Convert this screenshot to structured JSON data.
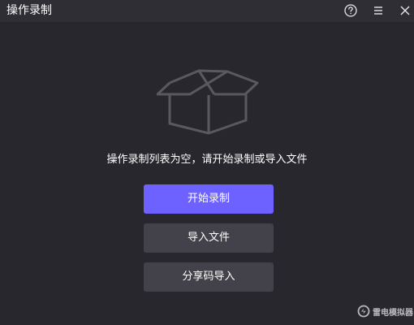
{
  "window": {
    "title": "操作录制"
  },
  "empty_state": {
    "message": "操作录制列表为空，请开始录制或导入文件",
    "icon": "empty-box-icon"
  },
  "actions": {
    "start_label": "开始录制",
    "import_label": "导入文件",
    "share_label": "分享码导入"
  },
  "watermark": {
    "text": "雷电模拟器"
  },
  "icons": {
    "help": "help-icon",
    "menu": "menu-icon",
    "close": "close-icon"
  },
  "colors": {
    "background": "#28272d",
    "titlebar": "#2f2e34",
    "accent": "#6d62ff",
    "secondary_button": "#43424a",
    "icon_stroke": "#5a5960"
  }
}
